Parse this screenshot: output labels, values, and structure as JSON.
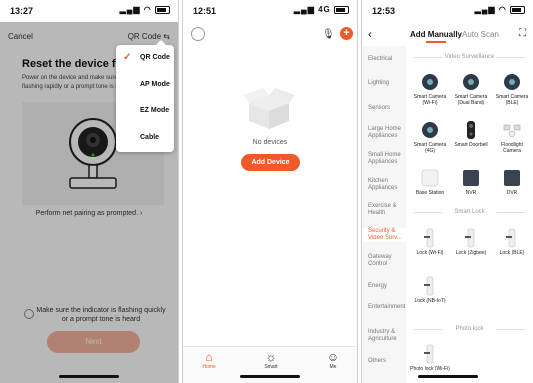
{
  "phone1": {
    "status_time": "13:27",
    "cancel_label": "Cancel",
    "mode_label": "QR Code",
    "title": "Reset the device first.",
    "description": "Power on the device and make sure the indicator is flashing rapidly or a prompt tone is h",
    "perform_link": "Perform net pairing as prompted.",
    "checkbox_label": "Make sure the indicator is flashing quickly or a prompt tone is heard",
    "next_label": "Next",
    "menu": [
      "QR Code",
      "AP Mode",
      "EZ Mode",
      "Cable"
    ],
    "selected_mode": "QR Code"
  },
  "phone2": {
    "status_time": "12:51",
    "network": "4G",
    "empty_text": "No devices",
    "add_device_label": "Add Device",
    "tabs": [
      {
        "label": "Home",
        "icon": "home-icon"
      },
      {
        "label": "Smart",
        "icon": "sun-icon"
      },
      {
        "label": "Me",
        "icon": "person-icon"
      }
    ]
  },
  "phone3": {
    "status_time": "12:53",
    "tab_manual": "Add Manually",
    "tab_auto": "Auto Scan",
    "categories": [
      "Electrical",
      "Lighting",
      "Sensors",
      "Large Home Appliances",
      "Small Home Appliances",
      "Kitchen Appliances",
      "Exercise & Health",
      "Security & Video Surv...",
      "Gateway Control",
      "Energy",
      "Entertainment",
      "Industry & Agriculture",
      "Others"
    ],
    "active_category": "Security & Video Surv...",
    "sections": [
      "Video Surveillance",
      "Smart Lock",
      "Photo lock"
    ],
    "video_devices": [
      "Smart Camera (Wi-Fi)",
      "Smart Camera (Dual Band)",
      "Smart Camera (BLE)",
      "Smart Camera (4G)",
      "Smart Doorbell",
      "Floodlight Camera",
      "Base Station",
      "NVR",
      "DVR"
    ],
    "lock_devices": [
      "Lock (Wi-Fi)",
      "Lock (Zigbee)",
      "Lock (BLE)",
      "Lock (NB-IoT)"
    ],
    "photo_devices": [
      "Photo lock (Wi-Fi)"
    ]
  },
  "accent_color": "#f05a28"
}
